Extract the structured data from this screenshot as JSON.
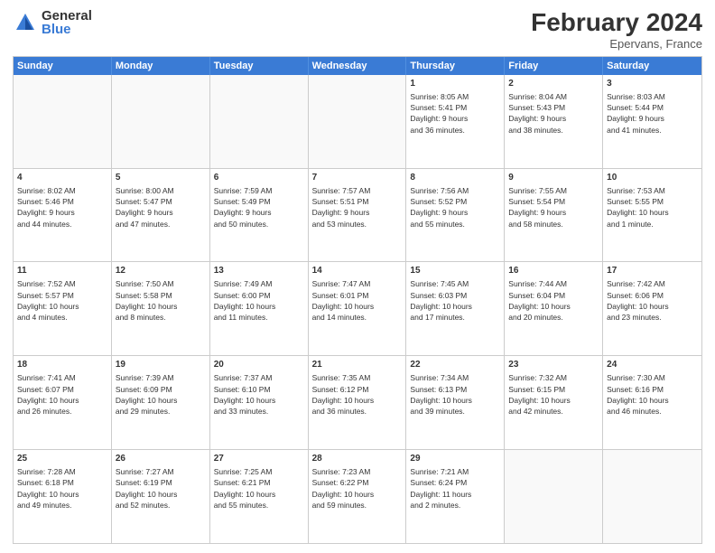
{
  "logo": {
    "general": "General",
    "blue": "Blue"
  },
  "header": {
    "month": "February 2024",
    "location": "Epervans, France"
  },
  "weekdays": [
    "Sunday",
    "Monday",
    "Tuesday",
    "Wednesday",
    "Thursday",
    "Friday",
    "Saturday"
  ],
  "rows": [
    [
      {
        "day": "",
        "info": ""
      },
      {
        "day": "",
        "info": ""
      },
      {
        "day": "",
        "info": ""
      },
      {
        "day": "",
        "info": ""
      },
      {
        "day": "1",
        "info": "Sunrise: 8:05 AM\nSunset: 5:41 PM\nDaylight: 9 hours\nand 36 minutes."
      },
      {
        "day": "2",
        "info": "Sunrise: 8:04 AM\nSunset: 5:43 PM\nDaylight: 9 hours\nand 38 minutes."
      },
      {
        "day": "3",
        "info": "Sunrise: 8:03 AM\nSunset: 5:44 PM\nDaylight: 9 hours\nand 41 minutes."
      }
    ],
    [
      {
        "day": "4",
        "info": "Sunrise: 8:02 AM\nSunset: 5:46 PM\nDaylight: 9 hours\nand 44 minutes."
      },
      {
        "day": "5",
        "info": "Sunrise: 8:00 AM\nSunset: 5:47 PM\nDaylight: 9 hours\nand 47 minutes."
      },
      {
        "day": "6",
        "info": "Sunrise: 7:59 AM\nSunset: 5:49 PM\nDaylight: 9 hours\nand 50 minutes."
      },
      {
        "day": "7",
        "info": "Sunrise: 7:57 AM\nSunset: 5:51 PM\nDaylight: 9 hours\nand 53 minutes."
      },
      {
        "day": "8",
        "info": "Sunrise: 7:56 AM\nSunset: 5:52 PM\nDaylight: 9 hours\nand 55 minutes."
      },
      {
        "day": "9",
        "info": "Sunrise: 7:55 AM\nSunset: 5:54 PM\nDaylight: 9 hours\nand 58 minutes."
      },
      {
        "day": "10",
        "info": "Sunrise: 7:53 AM\nSunset: 5:55 PM\nDaylight: 10 hours\nand 1 minute."
      }
    ],
    [
      {
        "day": "11",
        "info": "Sunrise: 7:52 AM\nSunset: 5:57 PM\nDaylight: 10 hours\nand 4 minutes."
      },
      {
        "day": "12",
        "info": "Sunrise: 7:50 AM\nSunset: 5:58 PM\nDaylight: 10 hours\nand 8 minutes."
      },
      {
        "day": "13",
        "info": "Sunrise: 7:49 AM\nSunset: 6:00 PM\nDaylight: 10 hours\nand 11 minutes."
      },
      {
        "day": "14",
        "info": "Sunrise: 7:47 AM\nSunset: 6:01 PM\nDaylight: 10 hours\nand 14 minutes."
      },
      {
        "day": "15",
        "info": "Sunrise: 7:45 AM\nSunset: 6:03 PM\nDaylight: 10 hours\nand 17 minutes."
      },
      {
        "day": "16",
        "info": "Sunrise: 7:44 AM\nSunset: 6:04 PM\nDaylight: 10 hours\nand 20 minutes."
      },
      {
        "day": "17",
        "info": "Sunrise: 7:42 AM\nSunset: 6:06 PM\nDaylight: 10 hours\nand 23 minutes."
      }
    ],
    [
      {
        "day": "18",
        "info": "Sunrise: 7:41 AM\nSunset: 6:07 PM\nDaylight: 10 hours\nand 26 minutes."
      },
      {
        "day": "19",
        "info": "Sunrise: 7:39 AM\nSunset: 6:09 PM\nDaylight: 10 hours\nand 29 minutes."
      },
      {
        "day": "20",
        "info": "Sunrise: 7:37 AM\nSunset: 6:10 PM\nDaylight: 10 hours\nand 33 minutes."
      },
      {
        "day": "21",
        "info": "Sunrise: 7:35 AM\nSunset: 6:12 PM\nDaylight: 10 hours\nand 36 minutes."
      },
      {
        "day": "22",
        "info": "Sunrise: 7:34 AM\nSunset: 6:13 PM\nDaylight: 10 hours\nand 39 minutes."
      },
      {
        "day": "23",
        "info": "Sunrise: 7:32 AM\nSunset: 6:15 PM\nDaylight: 10 hours\nand 42 minutes."
      },
      {
        "day": "24",
        "info": "Sunrise: 7:30 AM\nSunset: 6:16 PM\nDaylight: 10 hours\nand 46 minutes."
      }
    ],
    [
      {
        "day": "25",
        "info": "Sunrise: 7:28 AM\nSunset: 6:18 PM\nDaylight: 10 hours\nand 49 minutes."
      },
      {
        "day": "26",
        "info": "Sunrise: 7:27 AM\nSunset: 6:19 PM\nDaylight: 10 hours\nand 52 minutes."
      },
      {
        "day": "27",
        "info": "Sunrise: 7:25 AM\nSunset: 6:21 PM\nDaylight: 10 hours\nand 55 minutes."
      },
      {
        "day": "28",
        "info": "Sunrise: 7:23 AM\nSunset: 6:22 PM\nDaylight: 10 hours\nand 59 minutes."
      },
      {
        "day": "29",
        "info": "Sunrise: 7:21 AM\nSunset: 6:24 PM\nDaylight: 11 hours\nand 2 minutes."
      },
      {
        "day": "",
        "info": ""
      },
      {
        "day": "",
        "info": ""
      }
    ]
  ]
}
